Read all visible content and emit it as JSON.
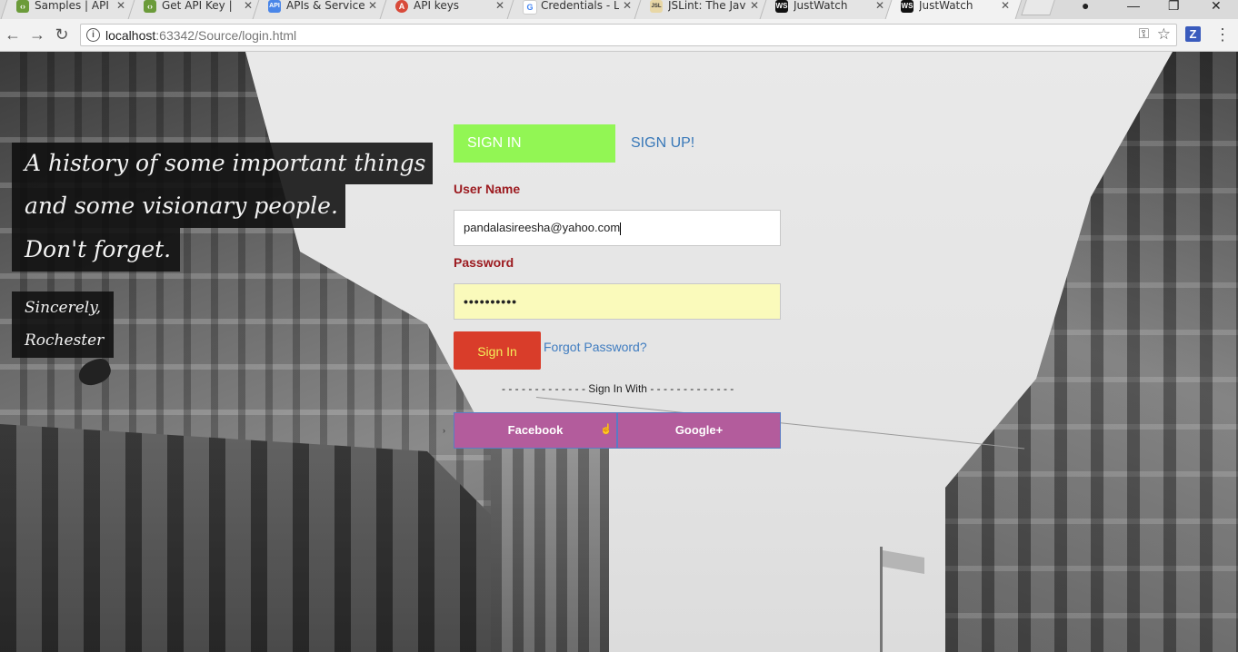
{
  "browser": {
    "tabs": [
      {
        "title": "Samples | API",
        "favicon": "code-icon",
        "active": false
      },
      {
        "title": "Get API Key |",
        "favicon": "code-icon",
        "active": false
      },
      {
        "title": "APIs & Services",
        "favicon": "api-icon",
        "active": false
      },
      {
        "title": "API keys",
        "favicon": "api-keys-icon",
        "active": false
      },
      {
        "title": "Credentials - L",
        "favicon": "google-icon",
        "active": false
      },
      {
        "title": "JSLint: The Jav",
        "favicon": "jslint-icon",
        "active": false
      },
      {
        "title": "JustWatch",
        "favicon": "webstorm-icon",
        "active": false
      },
      {
        "title": "JustWatch",
        "favicon": "webstorm-icon",
        "active": true
      }
    ],
    "url_host": "localhost",
    "url_rest": ":63342/Source/login.html",
    "extension_label": "Z"
  },
  "quote": {
    "line1": "A history of some important things",
    "line2": "and some visionary people.",
    "line3": "Don't forget.",
    "sign1": "Sincerely,",
    "sign2": "Rochester"
  },
  "form": {
    "tab_signin": "SIGN IN",
    "tab_signup": "SIGN UP!",
    "username_label": "User Name",
    "username_value": "pandalasireesha@yahoo.com",
    "password_label": "Password",
    "password_masked": "••••••••••",
    "signin_button": "Sign In",
    "forgot_link": "Forgot Password?",
    "signin_with": "- - - - - - - - - - - - - Sign In With - - - - - - - - - - - - -",
    "facebook_button": "Facebook",
    "google_button": "Google+"
  },
  "colors": {
    "signin_tab": "#92f654",
    "signin_button": "#d93d2a",
    "social_button": "#b35c9c",
    "label": "#9c1b20",
    "link": "#3878b8"
  }
}
